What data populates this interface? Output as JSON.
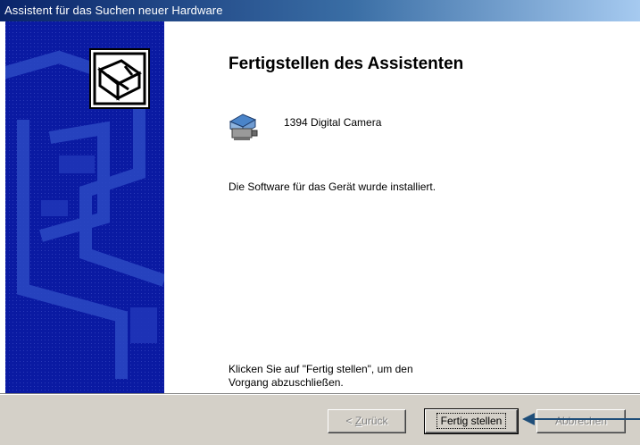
{
  "window": {
    "title": "Assistent für das Suchen neuer Hardware"
  },
  "content": {
    "heading": "Fertigstellen des Assistenten",
    "device_name": "1394 Digital Camera",
    "status": "Die Software für das Gerät wurde installiert.",
    "instructions_line1": "Klicken Sie auf \"Fertig stellen\", um den",
    "instructions_line2": "Vorgang abzuschließen."
  },
  "buttons": {
    "back_prefix": "< ",
    "back_access": "Z",
    "back_rest": "urück",
    "finish": "Fertig stellen",
    "cancel": "Abbrechen"
  },
  "icons": {
    "wizard": "hardware-wizard-icon",
    "device": "camera-device-icon",
    "annotation": "arrow-pointer-icon"
  },
  "colors": {
    "title_start": "#0a246a",
    "title_end": "#a6caf0",
    "sidebar": "#0a1aa2",
    "annotation": "#1f4e79"
  }
}
